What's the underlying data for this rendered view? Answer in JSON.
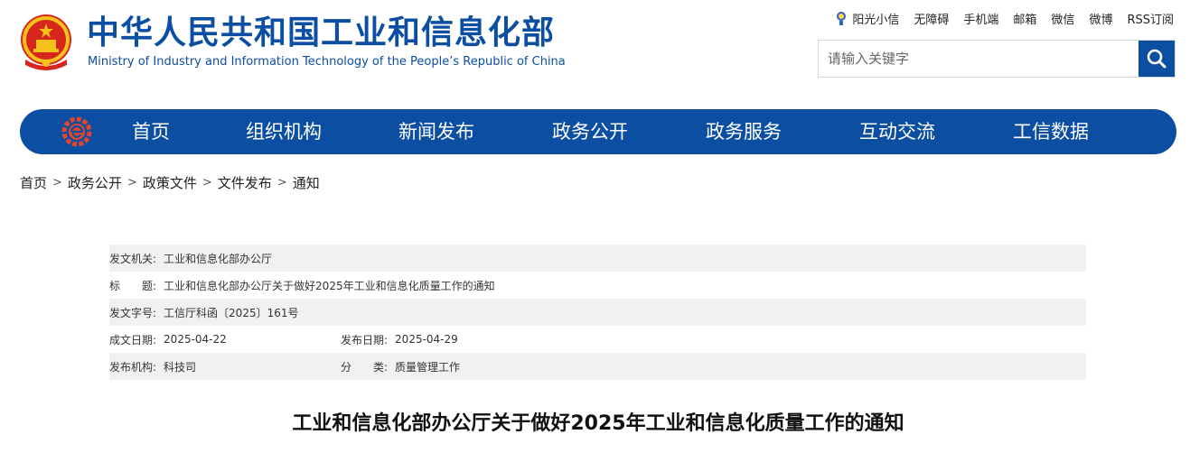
{
  "header": {
    "title_cn": "中华人民共和国工业和信息化部",
    "title_en": "Ministry of Industry and Information Technology of the People’s Republic of China",
    "top_links": [
      "阳光小信",
      "无障碍",
      "手机端",
      "邮箱",
      "微信",
      "微博",
      "RSS订阅"
    ],
    "search_placeholder": "请输入关键字",
    "brand_color": "#0b4ea2"
  },
  "nav": {
    "items": [
      "首页",
      "组织机构",
      "新闻发布",
      "政务公开",
      "政务服务",
      "互动交流",
      "工信数据"
    ]
  },
  "breadcrumb": [
    "首页",
    "政务公开",
    "政策文件",
    "文件发布",
    "通知"
  ],
  "breadcrumb_sep": ">",
  "meta": {
    "issuer_label": "发文机关:",
    "issuer": "工业和信息化部办公厅",
    "title_label": "标　　题:",
    "title": "工业和信息化部办公厅关于做好2025年工业和信息化质量工作的通知",
    "docno_label": "发文字号:",
    "docno": "工信厅科函〔2025〕161号",
    "created_label": "成文日期:",
    "created": "2025-04-22",
    "published_label": "发布日期:",
    "published": "2025-04-29",
    "agency_label": "发布机构:",
    "agency": "科技司",
    "category_label": "分　　类:",
    "category": "质量管理工作"
  },
  "document_title": "工业和信息化部办公厅关于做好2025年工业和信息化质量工作的通知"
}
